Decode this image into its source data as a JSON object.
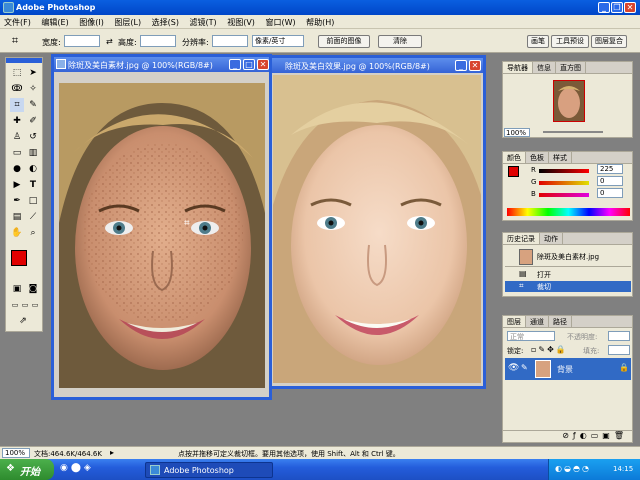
{
  "app": {
    "title": "Adobe Photoshop",
    "window_buttons": {
      "minimize": "_",
      "restore": "❐",
      "close": "✕"
    }
  },
  "menu": [
    "文件(F)",
    "编辑(E)",
    "图像(I)",
    "图层(L)",
    "选择(S)",
    "滤镜(T)",
    "视图(V)",
    "窗口(W)",
    "帮助(H)"
  ],
  "options_bar": {
    "width_label": "宽度:",
    "width_value": "",
    "height_label": "高度:",
    "height_value": "",
    "resolution_label": "分辨率:",
    "resolution_value": "",
    "unit_select": "像素/英寸",
    "front_image_button": "前面的图像",
    "clear_button": "清除",
    "right_buttons": [
      "画笔",
      "工具预设",
      "图层复合"
    ]
  },
  "doc1": {
    "title": "除斑及美白素材.jpg @ 100%(RGB/8#)",
    "window_buttons": {
      "minimize": "_",
      "maximize": "□",
      "close": "✕"
    }
  },
  "doc2": {
    "title": "除斑及美白效果.jpg @ 100%(RGB/8#)",
    "window_buttons": {
      "minimize": "_",
      "close": "✕"
    }
  },
  "navigator": {
    "tabs": [
      "导航器",
      "信息",
      "直方图"
    ],
    "zoom": "100%"
  },
  "color_palette": {
    "tabs": [
      "颜色",
      "色板",
      "样式"
    ],
    "channels": [
      {
        "label": "R",
        "value": "225"
      },
      {
        "label": "G",
        "value": "0"
      },
      {
        "label": "B",
        "value": "0"
      }
    ],
    "foreground": "#e00000"
  },
  "history": {
    "tabs": [
      "历史记录",
      "动作"
    ],
    "snapshot": "除斑及美白素材.jpg",
    "items": [
      "打开",
      "裁切"
    ]
  },
  "layers": {
    "tabs": [
      "图层",
      "通道",
      "路径"
    ],
    "blend_mode": "正常",
    "opacity_label": "不透明度:",
    "lock_label": "锁定:",
    "fill_label": "填充:",
    "layer_name": "背景"
  },
  "status": {
    "zoom": "100%",
    "doc_size": "文档:464.6K/464.6K",
    "hint": "点按并拖移可定义裁切框。要用其他选项，使用 Shift、Alt 和 Ctrl 键。"
  },
  "taskbar": {
    "start": "开始",
    "task": "Adobe Photoshop",
    "clock": "14:15"
  },
  "colors": {
    "title_blue": "#0a5fe0",
    "accent_selected": "#316ac5",
    "foreground_color": "#e00000"
  }
}
